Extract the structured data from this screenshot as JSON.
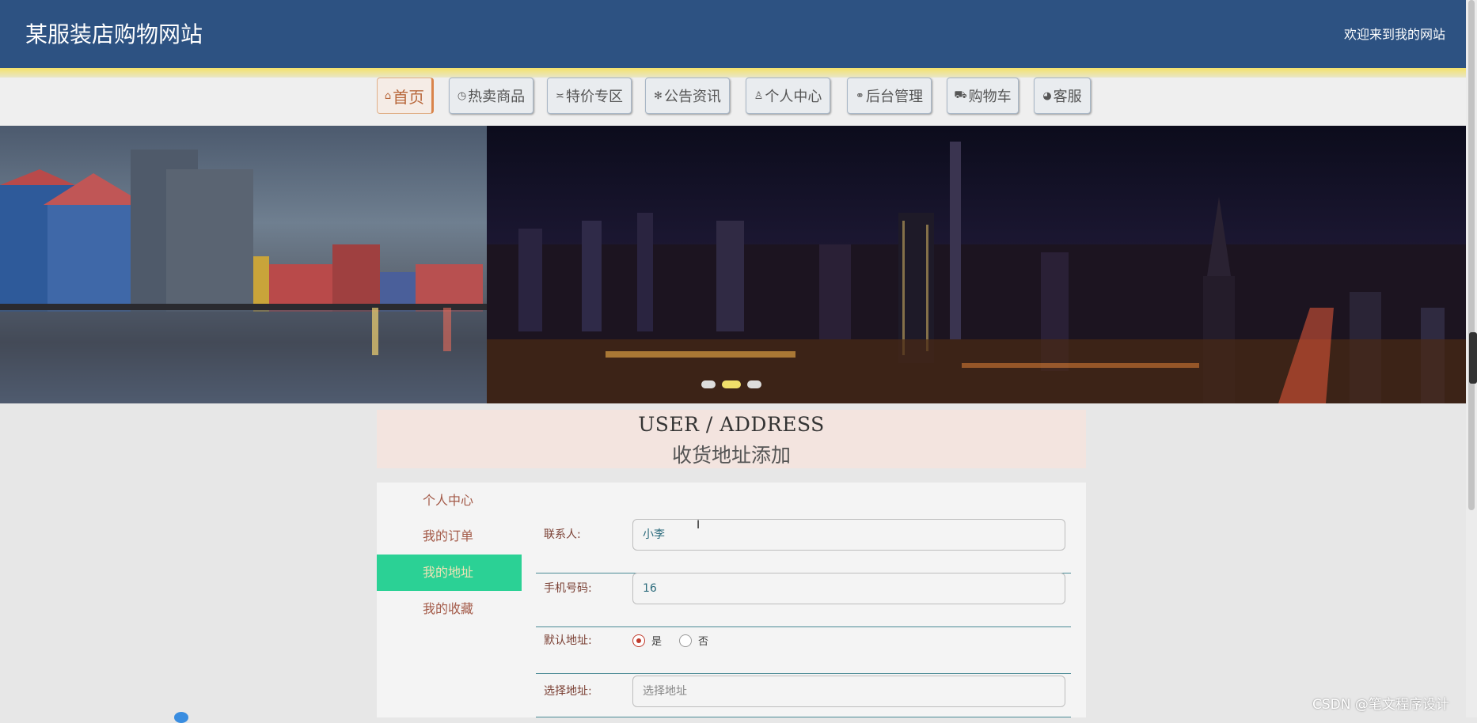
{
  "header": {
    "title": "某服装店购物网站",
    "welcome": "欢迎来到我的网站"
  },
  "nav": {
    "items": [
      {
        "icon": "⌂",
        "label": "首页",
        "active": true
      },
      {
        "icon": "◷",
        "label": "热卖商品"
      },
      {
        "icon": "≍",
        "label": "特价专区"
      },
      {
        "icon": "✻",
        "label": "公告资讯"
      },
      {
        "icon": "♙",
        "label": "个人中心"
      },
      {
        "icon": "⚭",
        "label": "后台管理"
      },
      {
        "icon": "⛟",
        "label": "购物车"
      },
      {
        "icon": "◕",
        "label": "客服"
      }
    ]
  },
  "banner": {
    "indicator_count": 3,
    "active_indicator": 1
  },
  "section": {
    "title_en": "USER / ADDRESS",
    "title_cn": "收货地址添加"
  },
  "sidebar": {
    "items": [
      {
        "label": "个人中心"
      },
      {
        "label": "我的订单"
      },
      {
        "label": "我的地址",
        "active": true
      },
      {
        "label": "我的收藏"
      }
    ]
  },
  "form": {
    "contact_label": "联系人:",
    "contact_value": "小李",
    "phone_label": "手机号码:",
    "phone_value": "16",
    "default_label": "默认地址:",
    "default_yes": "是",
    "default_no": "否",
    "default_selected": "是",
    "address_label": "选择地址:",
    "address_placeholder": "选择地址"
  },
  "watermark": "CSDN @笔文程序设计",
  "colors": {
    "header_bg": "#2d5282",
    "accent_green": "#2bd195",
    "section_bg": "#f3e4df"
  }
}
